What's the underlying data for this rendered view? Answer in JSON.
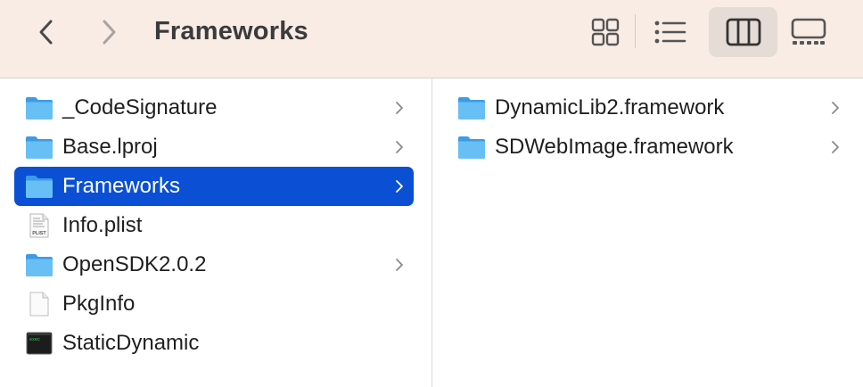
{
  "toolbar": {
    "title": "Frameworks",
    "back_icon": "chevron-left-icon",
    "forward_icon": "chevron-right-icon",
    "view_modes": [
      "icon-view",
      "list-view",
      "column-view",
      "gallery-view"
    ],
    "active_view": "column-view"
  },
  "columns": [
    {
      "items": [
        {
          "label": "_CodeSignature",
          "icon": "folder-icon",
          "has_children": true,
          "selected": false
        },
        {
          "label": "Base.lproj",
          "icon": "folder-icon",
          "has_children": true,
          "selected": false
        },
        {
          "label": "Frameworks",
          "icon": "folder-icon",
          "has_children": true,
          "selected": true
        },
        {
          "label": "Info.plist",
          "icon": "plist-file-icon",
          "has_children": false,
          "selected": false
        },
        {
          "label": "OpenSDK2.0.2",
          "icon": "folder-icon",
          "has_children": true,
          "selected": false
        },
        {
          "label": "PkgInfo",
          "icon": "document-icon",
          "has_children": false,
          "selected": false
        },
        {
          "label": "StaticDynamic",
          "icon": "terminal-exec-icon",
          "has_children": false,
          "selected": false
        }
      ]
    },
    {
      "items": [
        {
          "label": "DynamicLib2.framework",
          "icon": "folder-icon",
          "has_children": true,
          "selected": false
        },
        {
          "label": "SDWebImage.framework",
          "icon": "folder-icon",
          "has_children": true,
          "selected": false
        }
      ]
    }
  ],
  "colors": {
    "toolbar_bg": "#f8ece5",
    "selection": "#0a4fd4",
    "folder": "#5ab7f5"
  }
}
